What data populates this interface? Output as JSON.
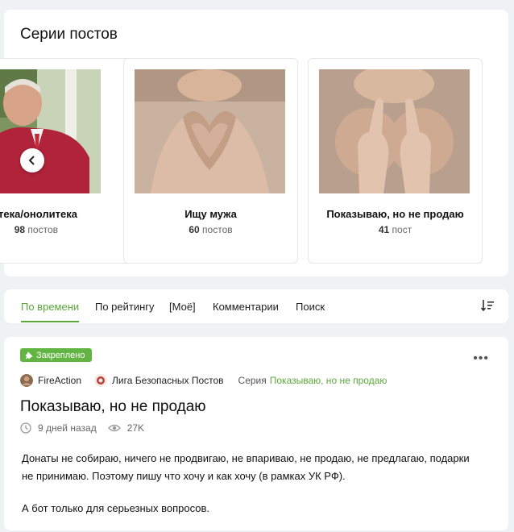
{
  "series": {
    "title": "Серии постов",
    "items": [
      {
        "name": "тека/онолитека",
        "count": "98",
        "count_label": "постов"
      },
      {
        "name": "Ищу мужа",
        "count": "60",
        "count_label": "постов"
      },
      {
        "name": "Показываю, но не продаю",
        "count": "41",
        "count_label": "пост"
      }
    ]
  },
  "tabs": {
    "items": [
      "По времени",
      "По рейтингу",
      "[Моё]",
      "Комментарии",
      "Поиск"
    ],
    "active_index": 0
  },
  "post": {
    "pinned": "Закреплено",
    "author": "FireAction",
    "community": "Лига Безопасных Постов",
    "series_label": "Серия",
    "series_name": "Показываю, но не продаю",
    "title": "Показываю, но не продаю",
    "time": "9 дней назад",
    "views": "27K",
    "body": [
      "Донаты не собираю, ничего не продвигаю, не впариваю, не продаю, не предлагаю, подарки не принимаю. Поэтому пишу что хочу и как хочу (в рамках УК РФ).",
      "А бот только для серьезных вопросов."
    ]
  },
  "colors": {
    "accent": "#5aa83a",
    "badge": "#62b543",
    "background": "#f0f1f3"
  },
  "icons": [
    "chevron-left-icon",
    "sort-icon",
    "pin-icon",
    "more-icon",
    "clock-icon",
    "eye-icon"
  ]
}
